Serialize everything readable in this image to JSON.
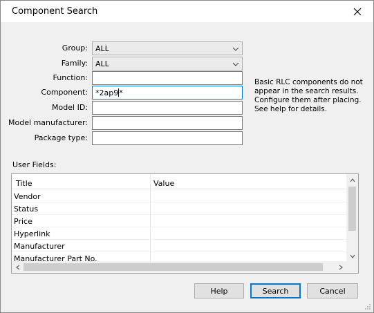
{
  "window": {
    "title": "Component Search"
  },
  "form": {
    "group": {
      "label": "Group:",
      "value": "ALL"
    },
    "family": {
      "label": "Family:",
      "value": "ALL"
    },
    "function": {
      "label": "Function:",
      "value": ""
    },
    "component": {
      "label": "Component:",
      "value_before_caret": "*2ap9",
      "value_after_caret": "*"
    },
    "model_id": {
      "label": "Model ID:",
      "value": ""
    },
    "model_manufacturer": {
      "label": "Model manufacturer:",
      "value": ""
    },
    "package_type": {
      "label": "Package type:",
      "value": ""
    }
  },
  "hint": "Basic RLC components do not appear in the search results. Configure them after placing. See help for details.",
  "user_fields": {
    "label": "User Fields:",
    "columns": [
      "Title",
      "Value"
    ],
    "rows": [
      {
        "title": "Vendor",
        "value": ""
      },
      {
        "title": "Status",
        "value": ""
      },
      {
        "title": "Price",
        "value": ""
      },
      {
        "title": "Hyperlink",
        "value": ""
      },
      {
        "title": "Manufacturer",
        "value": ""
      },
      {
        "title": "Manufacturer Part No.",
        "value": ""
      }
    ]
  },
  "buttons": {
    "help": "Help",
    "search": "Search",
    "cancel": "Cancel"
  },
  "colors": {
    "accent": "#0078d7",
    "dialog_bg": "#f0f0f0"
  },
  "icons": {
    "close": "close-icon",
    "dropdown": "chevron-down-icon"
  }
}
